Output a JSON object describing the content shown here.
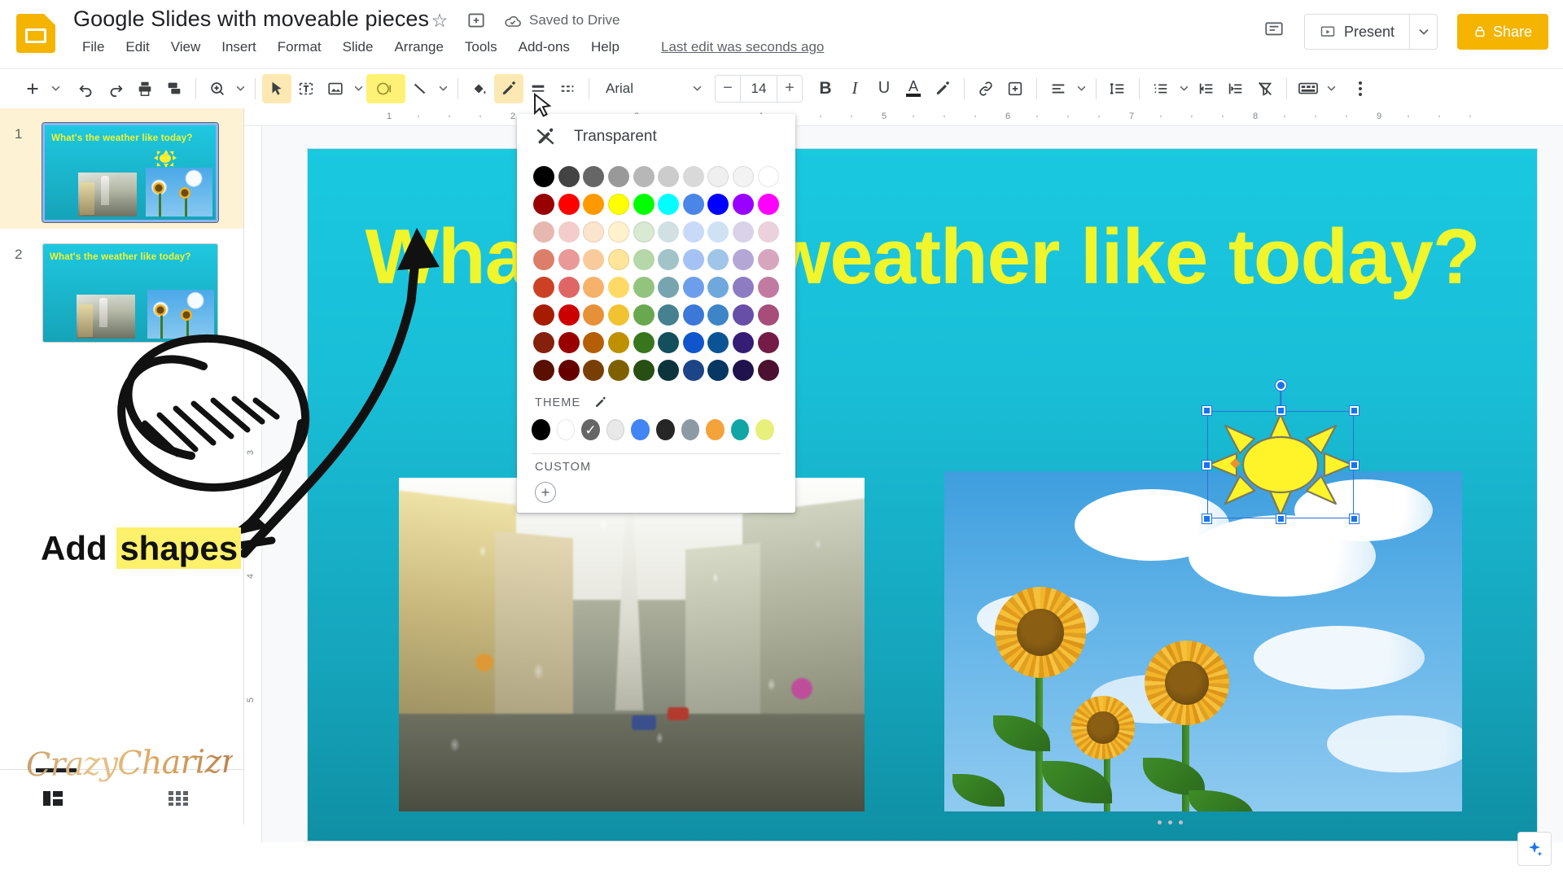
{
  "header": {
    "logo_icon": "slides-logo-icon",
    "doc_title": "Google Slides with moveable pieces",
    "star_icon": "star-icon",
    "move_folder_icon": "move-to-folder-icon",
    "cloud_icon": "cloud-saved-icon",
    "save_status": "Saved to Drive",
    "last_edit": "Last edit was seconds ago",
    "menus": [
      "File",
      "Edit",
      "View",
      "Insert",
      "Format",
      "Slide",
      "Arrange",
      "Tools",
      "Add-ons",
      "Help"
    ],
    "comment_icon": "comment-icon",
    "present_label": "Present",
    "present_icon": "present-screen-icon",
    "present_caret_icon": "chevron-down-icon",
    "share_label": "Share",
    "share_icon": "lock-icon"
  },
  "toolbar": {
    "new_slide_icon": "plus-icon",
    "new_slide_caret_icon": "chevron-down-icon",
    "undo_icon": "undo-icon",
    "redo_icon": "redo-icon",
    "print_icon": "print-icon",
    "paint_format_icon": "paint-format-icon",
    "zoom_icon": "zoom-icon",
    "zoom_caret_icon": "chevron-down-icon",
    "select_icon": "cursor-arrow-icon",
    "textbox_icon": "text-box-icon",
    "image_icon": "insert-image-icon",
    "image_caret_icon": "chevron-down-icon",
    "shape_icon": "shape-icon",
    "line_icon": "line-icon",
    "line_caret_icon": "chevron-down-icon",
    "fill_color_icon": "fill-color-icon",
    "border_color_icon": "border-color-pencil-icon",
    "border_weight_icon": "border-weight-icon",
    "border_dash_icon": "border-dash-icon",
    "font_family": "Arial",
    "font_caret_icon": "chevron-down-icon",
    "font_decrease_icon": "minus-icon",
    "font_size": "14",
    "font_increase_icon": "plus-icon",
    "bold_label": "B",
    "italic_label": "I",
    "underline_label": "U",
    "text_color_label": "A",
    "highlight_icon": "highlight-pen-icon",
    "link_icon": "link-icon",
    "comment_add_icon": "add-comment-icon",
    "align_icon": "align-left-icon",
    "align_caret_icon": "chevron-down-icon",
    "line_spacing_icon": "line-spacing-icon",
    "list_icon": "numbered-list-icon",
    "list_caret_icon": "chevron-down-icon",
    "indent_decrease_icon": "indent-decrease-icon",
    "indent_increase_icon": "indent-increase-icon",
    "clear_format_icon": "clear-formatting-icon",
    "transition_icon": "transition-icon",
    "transition_caret_icon": "chevron-down-icon",
    "more_icon": "more-options-icon",
    "highlighted_tools": [
      "shape-icon",
      "border-color-pencil-icon",
      "cursor-arrow-icon"
    ]
  },
  "slide_panel": {
    "slides": [
      {
        "number": "1",
        "title": "What's the weather like today?",
        "selected": true
      },
      {
        "number": "2",
        "title": "What's the weather like today?",
        "selected": false
      }
    ],
    "filmstrip_icon": "filmstrip-view-icon",
    "grid_icon": "grid-view-icon"
  },
  "ruler": {
    "h_marks": [
      "1",
      "2",
      "3",
      "4",
      "5",
      "6",
      "7",
      "8",
      "9"
    ],
    "v_marks": [
      "3",
      "4",
      "5"
    ]
  },
  "canvas": {
    "slide_title": "What's the weather like today?",
    "background_top": "#19c9e0",
    "background_bottom": "#0f8fa4",
    "title_color": "#f0f52c",
    "selected_shape": "sun-shape",
    "sun_fill": "#fff429",
    "sun_border": "#7a7a5a"
  },
  "color_picker": {
    "transparent_label": "Transparent",
    "transparent_icon": "no-color-icon",
    "theme_label": "THEME",
    "theme_edit_icon": "pencil-edit-icon",
    "custom_label": "CUSTOM",
    "custom_add_icon": "plus-circle-icon",
    "selected_swatch_index": 2,
    "grid_colors": [
      [
        "#000000",
        "#434343",
        "#666666",
        "#999999",
        "#b7b7b7",
        "#cccccc",
        "#d9d9d9",
        "#efefef",
        "#f3f3f3",
        "#ffffff"
      ],
      [
        "#980000",
        "#ff0000",
        "#ff9900",
        "#ffff00",
        "#00ff00",
        "#00ffff",
        "#4a86e8",
        "#0000ff",
        "#9900ff",
        "#ff00ff"
      ],
      [
        "#e6b8af",
        "#f4cccc",
        "#fce5cd",
        "#fff2cc",
        "#d9ead3",
        "#d0e0e3",
        "#c9daf8",
        "#cfe2f3",
        "#d9d2e9",
        "#ead1dc"
      ],
      [
        "#dd7e6b",
        "#ea9999",
        "#f9cb9c",
        "#ffe599",
        "#b6d7a8",
        "#a2c4c9",
        "#a4c2f4",
        "#9fc5e8",
        "#b4a7d6",
        "#d5a6bd"
      ],
      [
        "#cc4125",
        "#e06666",
        "#f6b26b",
        "#ffd966",
        "#93c47d",
        "#76a5af",
        "#6d9eeb",
        "#6fa8dc",
        "#8e7cc3",
        "#c27ba0"
      ],
      [
        "#a61c00",
        "#cc0000",
        "#e69138",
        "#f1c232",
        "#6aa84f",
        "#45818e",
        "#3c78d8",
        "#3d85c6",
        "#674ea7",
        "#a64d79"
      ],
      [
        "#85200c",
        "#990000",
        "#b45f06",
        "#bf9000",
        "#38761d",
        "#134f5c",
        "#1155cc",
        "#0b5394",
        "#351c75",
        "#741b47"
      ],
      [
        "#5b0f00",
        "#660000",
        "#783f04",
        "#7f6000",
        "#274e13",
        "#0c343d",
        "#1c4587",
        "#073763",
        "#20124d",
        "#4c1130"
      ]
    ],
    "theme_colors": [
      "#000000",
      "#ffffff",
      "#666666",
      "#e8e8e8",
      "#4285f4",
      "#262626",
      "#8e9aa3",
      "#f4a33a",
      "#11a5a5",
      "#e6f07a"
    ]
  },
  "annotations": {
    "add_shapes_prefix": "Add ",
    "add_shapes_highlight": "shapes",
    "watermark": "CrazyCharizma"
  },
  "bottom": {
    "explore_icon": "explore-sparkle-icon"
  }
}
